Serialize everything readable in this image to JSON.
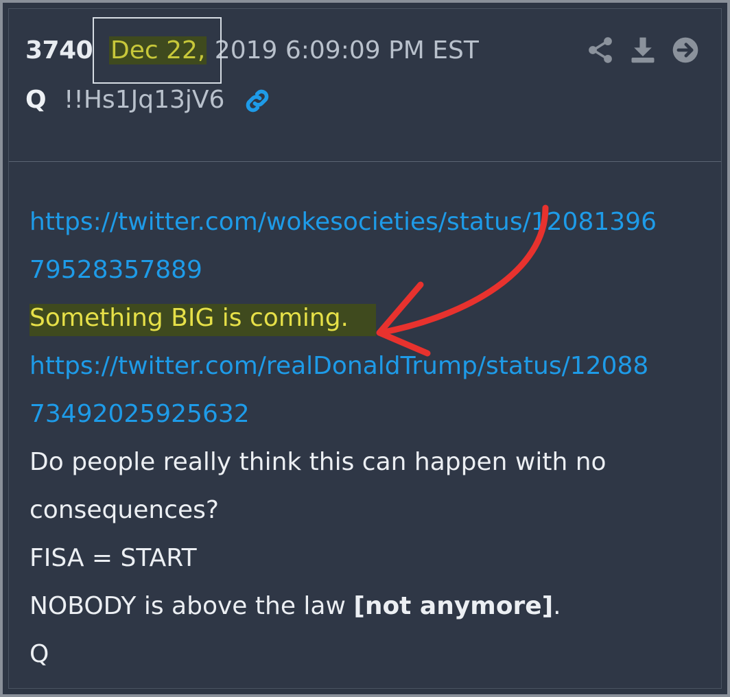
{
  "post": {
    "number": "3740",
    "date_highlight": "Dec 22,",
    "date_rest": " 2019 6:09:09 PM EST",
    "author": "Q",
    "tripcode": "!!Hs1Jq13jV6"
  },
  "icons": {
    "share": "share-icon",
    "download": "download-icon",
    "next": "arrow-right-circle-icon",
    "permalink": "link-icon"
  },
  "content": {
    "link1_line1": "https://twitter.com/wokesocieties/status/12081396",
    "link1_line2": "79528357889",
    "highlight": "Something BIG is coming.",
    "link2_line1": "https://twitter.com/realDonaldTrump/status/12088",
    "link2_line2": "73492025925632",
    "question_line1": "Do people really think this can happen with no",
    "question_line2": "consequences?",
    "fisa": "FISA = START",
    "nobody_prefix": "NOBODY is above the law ",
    "nobody_bold": "[not anymore]",
    "nobody_suffix": ".",
    "signature": "Q"
  },
  "colors": {
    "background": "#2f3746",
    "link": "#1e9be8",
    "highlight_text": "#e6e048",
    "arrow": "#e8322e"
  }
}
